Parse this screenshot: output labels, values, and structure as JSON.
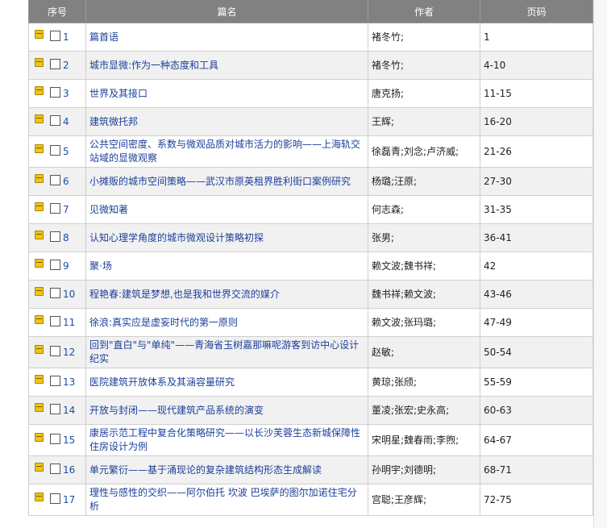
{
  "table": {
    "headers": {
      "no": "序号",
      "title": "篇名",
      "author": "作者",
      "pages": "页码"
    },
    "rows": [
      {
        "no": "1",
        "title": "篇首语",
        "author": "褚冬竹;",
        "pages": "1"
      },
      {
        "no": "2",
        "title": "城市显微:作为一种态度和工具",
        "author": "褚冬竹;",
        "pages": "4-10"
      },
      {
        "no": "3",
        "title": "世界及其接口",
        "author": "唐克扬;",
        "pages": "11-15"
      },
      {
        "no": "4",
        "title": "建筑微托邦",
        "author": "王辉;",
        "pages": "16-20"
      },
      {
        "no": "5",
        "title": "公共空间密度、系数与微观品质对城市活力的影响——上海轨交站域的显微观察",
        "author": "徐磊青;刘念;卢济威;",
        "pages": "21-26"
      },
      {
        "no": "6",
        "title": "小摊贩的城市空间策略——武汉市原英租界胜利街口案例研究",
        "author": "杨璐;汪原;",
        "pages": "27-30"
      },
      {
        "no": "7",
        "title": "见微知著",
        "author": "何志森;",
        "pages": "31-35"
      },
      {
        "no": "8",
        "title": "认知心理学角度的城市微观设计策略初探",
        "author": "张男;",
        "pages": "36-41"
      },
      {
        "no": "9",
        "title": "聚·场",
        "author": "赖文波;魏书祥;",
        "pages": "42"
      },
      {
        "no": "10",
        "title": "程艳春:建筑是梦想,也是我和世界交流的媒介",
        "author": "魏书祥;赖文波;",
        "pages": "43-46"
      },
      {
        "no": "11",
        "title": "徐浪:真实应是虚妄时代的第一原则",
        "author": "赖文波;张玛璐;",
        "pages": "47-49"
      },
      {
        "no": "12",
        "title": "回到\"直白\"与\"单纯\"——青海省玉树嘉那嘛呢游客到访中心设计纪实",
        "author": "赵敏;",
        "pages": "50-54"
      },
      {
        "no": "13",
        "title": "医院建筑开放体系及其涵容量研究",
        "author": "黄琼;张颀;",
        "pages": "55-59"
      },
      {
        "no": "14",
        "title": "开放与封闭——现代建筑产品系统的演变",
        "author": "董凌;张宏;史永高;",
        "pages": "60-63"
      },
      {
        "no": "15",
        "title": "康居示范工程中复合化策略研究——以长沙芙蓉生态新城保障性住房设计为例",
        "author": "宋明星;魏春雨;李煦;",
        "pages": "64-67"
      },
      {
        "no": "16",
        "title": "单元繁衍——基于涌现论的复杂建筑结构形态生成解读",
        "author": "孙明宇;刘德明;",
        "pages": "68-71"
      },
      {
        "no": "17",
        "title": "理性与感性的交织——阿尔伯托 坎波 巴埃萨的图尔加诺住宅分析",
        "author": "宫聪;王彦辉;",
        "pages": "72-75"
      }
    ]
  },
  "colors": {
    "header_bg": "#818181",
    "row_alt_bg": "#f1f1f1",
    "link": "#1b3f9a"
  }
}
